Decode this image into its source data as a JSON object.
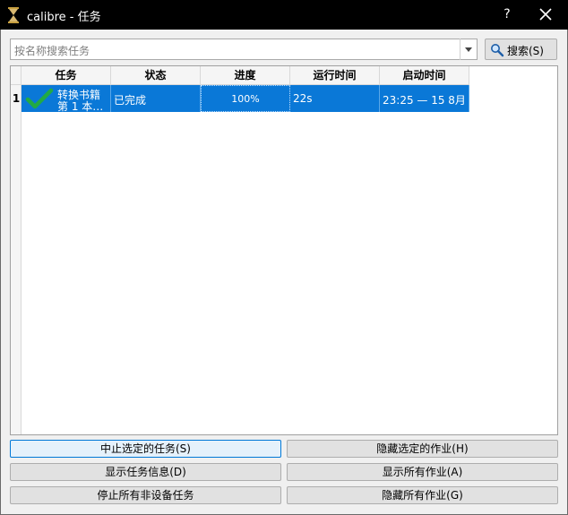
{
  "window": {
    "title": "calibre - 任务",
    "help_label": "?"
  },
  "search": {
    "placeholder": "按名称搜索任务",
    "button_label": "搜索(S)"
  },
  "table": {
    "columns": [
      "任务",
      "状态",
      "进度",
      "运行时间",
      "启动时间"
    ],
    "rows": [
      {
        "index": "1",
        "job_line1": "转换书籍",
        "job_line2": "第 1 本…",
        "status": "已完成",
        "progress": "100%",
        "run_time": "22s",
        "start_time": "23:25 — 15 8月"
      }
    ]
  },
  "buttons": {
    "abort_selected": "中止选定的任务(S)",
    "hide_selected": "隐藏选定的作业(H)",
    "show_details": "显示任务信息(D)",
    "show_all": "显示所有作业(A)",
    "stop_all_non_device": "停止所有非设备任务",
    "hide_all": "隐藏所有作业(G)"
  },
  "colors": {
    "selection": "#0a78d7",
    "title_bar": "#000000",
    "check_icon": "#22aa44"
  }
}
